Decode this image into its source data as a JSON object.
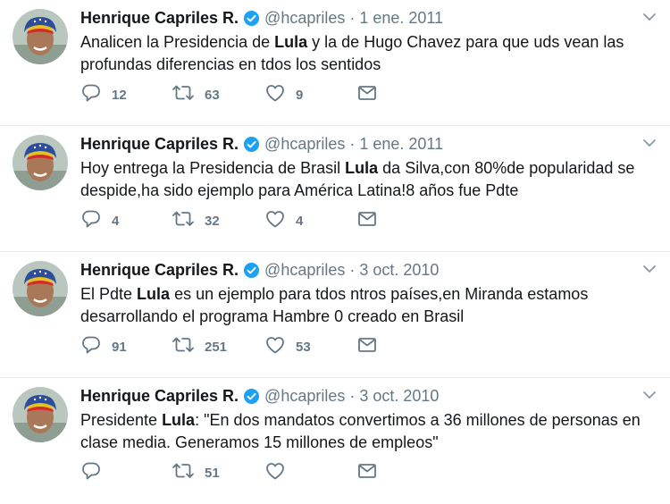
{
  "profile": {
    "name": "Henrique Capriles R.",
    "handle": "@hcapriles"
  },
  "colors": {
    "verified": "#1da1f2",
    "text": "#14171a",
    "muted": "#657786",
    "divider": "#e6ecf0"
  },
  "icons": [
    "verified-badge-icon",
    "chevron-down-icon",
    "reply-icon",
    "retweet-icon",
    "like-icon",
    "direct-message-icon"
  ],
  "tweets": [
    {
      "date": "1 ene. 2011",
      "line1": {
        "before": "Analicen la Presidencia de ",
        "bold": "Lula",
        "after": " y la de Hugo Chavez para que uds vean las"
      },
      "line2": "profundas diferencias en tdos los sentidos",
      "replies": "12",
      "retweets": "63",
      "likes": "9"
    },
    {
      "date": "1 ene. 2011",
      "line1": {
        "before": "Hoy entrega la Presidencia de Brasil ",
        "bold": "Lula",
        "after": " da Silva,con 80%de popularidad se"
      },
      "line2": "despide,ha sido ejemplo para América Latina!8 años fue Pdte",
      "replies": "4",
      "retweets": "32",
      "likes": "4"
    },
    {
      "date": "3 oct. 2010",
      "line1": {
        "before": "El Pdte ",
        "bold": "Lula",
        "after": " es un ejemplo para tdos ntros países,en Miranda estamos"
      },
      "line2": "desarrollando el programa Hambre 0 creado en Brasil",
      "replies": "91",
      "retweets": "251",
      "likes": "53"
    },
    {
      "date": "3 oct. 2010",
      "line1": {
        "before": "Presidente ",
        "bold": "Lula",
        "after": ": \"En dos mandatos convertimos a 36 millones de personas en"
      },
      "line2": "clase media. Generamos 15 millones de empleos\"",
      "replies": "",
      "retweets": "51",
      "likes": ""
    }
  ]
}
